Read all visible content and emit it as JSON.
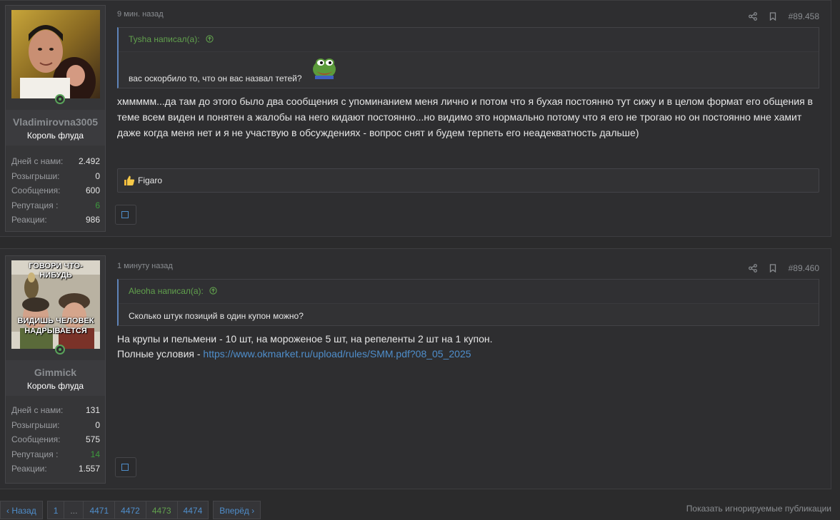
{
  "posts": [
    {
      "timestamp": "9 мин. назад",
      "post_number": "#89.458",
      "user": {
        "name": "Vladimirovna3005",
        "title": "Король флуда",
        "stats": [
          {
            "label": "Дней с нами:",
            "value": "2.492"
          },
          {
            "label": "Розыгрыши:",
            "value": "0"
          },
          {
            "label": "Сообщения:",
            "value": "600"
          },
          {
            "label": "Репутация :",
            "value": "6"
          },
          {
            "label": "Реакции:",
            "value": "986"
          }
        ]
      },
      "quote": {
        "author": "Tysha написал(а):",
        "text": "вас оскорбило то, что он вас назвал тетей?"
      },
      "message": "хммммм...да там до этого было два сообщения с упоминанием меня лично и потом что я бухая постоянно тут сижу и в целом формат его общения в теме всем виден и понятен а жалобы на него кидают постоянно...но видимо это нормально потому что я его не трогаю но он постоянно мне хамит даже когда меня нет и я не участвую в обсуждениях - вопрос снят и будем терпеть его неадекватность дальше)",
      "reaction_user": "Figaro"
    },
    {
      "timestamp": "1 минуту назад",
      "post_number": "#89.460",
      "user": {
        "name": "Gimmick",
        "title": "Король флуда",
        "avatar_caption_top": "ГОВОРИ ЧТО-НИБУДЬ",
        "avatar_caption_bottom": "ВИДИШЬ ЧЕЛОВЕК НАДРЫВАЕТСЯ",
        "stats": [
          {
            "label": "Дней с нами:",
            "value": "131"
          },
          {
            "label": "Розыгрыши:",
            "value": "0"
          },
          {
            "label": "Сообщения:",
            "value": "575"
          },
          {
            "label": "Репутация :",
            "value": "14"
          },
          {
            "label": "Реакции:",
            "value": "1.557"
          }
        ]
      },
      "quote": {
        "author": "Aleoha написал(а):",
        "text": "Сколько штук позиций в один купон можно?"
      },
      "message_line1": "На крупы и пельмени - 10 шт, на мороженое 5 шт, на репеленты 2 шт на 1 купон.",
      "message_line2_prefix": "Полные условия - ",
      "message_link": "https://www.okmarket.ru/upload/rules/SMM.pdf?08_05_2025"
    }
  ],
  "pagination": {
    "prev": "Назад",
    "pages": [
      "1",
      "...",
      "4471",
      "4472",
      "4473",
      "4474"
    ],
    "current": "4473",
    "next": "Вперёд"
  },
  "show_ignored": "Показать игнорируемые публикации",
  "colors": {
    "accent": "#4f8ecb",
    "green": "#61a04d",
    "background": "#2b2b2c"
  }
}
